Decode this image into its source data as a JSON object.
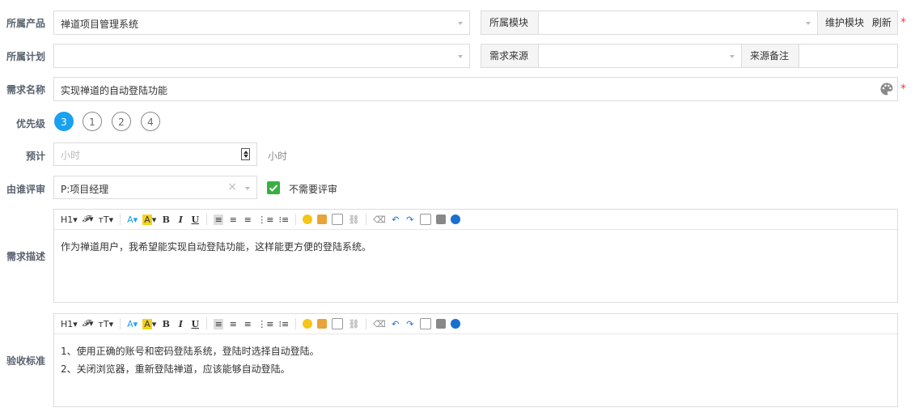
{
  "product": {
    "label": "所属产品",
    "value": "禅道项目管理系统"
  },
  "module": {
    "label": "所属模块",
    "value": "",
    "maintain": "维护模块",
    "refresh": "刷新"
  },
  "plan": {
    "label": "所属计划",
    "value": ""
  },
  "source": {
    "label": "需求来源",
    "value": "",
    "note_label": "来源备注",
    "note_value": ""
  },
  "title": {
    "label": "需求名称",
    "value": "实现禅道的自动登陆功能"
  },
  "priority": {
    "label": "优先级",
    "options": [
      "3",
      "1",
      "2",
      "4"
    ],
    "selected": "3"
  },
  "estimate": {
    "label": "预计",
    "placeholder": "小时",
    "unit": "小时"
  },
  "reviewer": {
    "label": "由谁评审",
    "value": "P:项目经理",
    "clear": "×",
    "no_review": "不需要评审",
    "no_review_checked": true
  },
  "toolbar": {
    "h1": "H1",
    "font": "𝓕",
    "size": "тT",
    "fontcolor": "A",
    "bgcolor": "A",
    "bold": "B",
    "italic": "I",
    "underline": "U"
  },
  "spec": {
    "label": "需求描述",
    "lines": [
      "作为禅道用户，我希望能实现自动登陆功能，这样能更方便的登陆系统。"
    ]
  },
  "verify": {
    "label": "验收标准",
    "lines": [
      "1、使用正确的账号和密码登陆系统，登陆时选择自动登陆。",
      "2、关闭浏览器，重新登陆禅道，应该能够自动登陆。"
    ]
  }
}
